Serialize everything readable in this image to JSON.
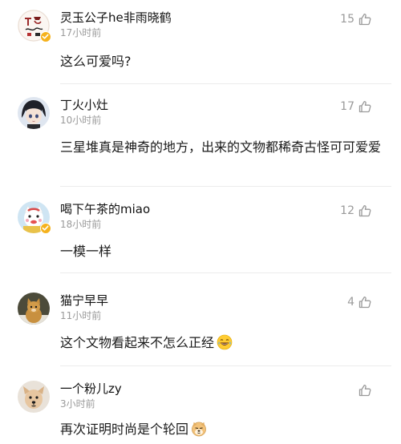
{
  "comments": [
    {
      "username": "灵玉公子he非雨晓鹤",
      "time": "17小时前",
      "likes": "15",
      "text": "这么可爱吗?",
      "verified": true,
      "emoji": ""
    },
    {
      "username": "丁火小灶",
      "time": "10小时前",
      "likes": "17",
      "text": "三星堆真是神奇的地方，出来的文物都稀奇古怪可可爱爱",
      "verified": false,
      "emoji": ""
    },
    {
      "username": "喝下午茶的miao",
      "time": "18小时前",
      "likes": "12",
      "text": "一模一样",
      "verified": true,
      "emoji": ""
    },
    {
      "username": "猫宁早早",
      "time": "11小时前",
      "likes": "4",
      "text": "这个文物看起来不怎么正经",
      "verified": false,
      "emoji": "laughing-tears-emoji"
    },
    {
      "username": "一个粉儿zy",
      "time": "3小时前",
      "likes": "",
      "text": "再次证明时尚是个轮回",
      "verified": false,
      "emoji": "doge-emoji"
    }
  ],
  "colors": {
    "muted_text": "#9a9a9a",
    "body_text": "#1a1a1a",
    "verified_badge": "#f5b21d",
    "divider": "#ececec"
  },
  "icons": {
    "like": "thumbs-up-icon",
    "verified": "verified-badge-icon"
  }
}
